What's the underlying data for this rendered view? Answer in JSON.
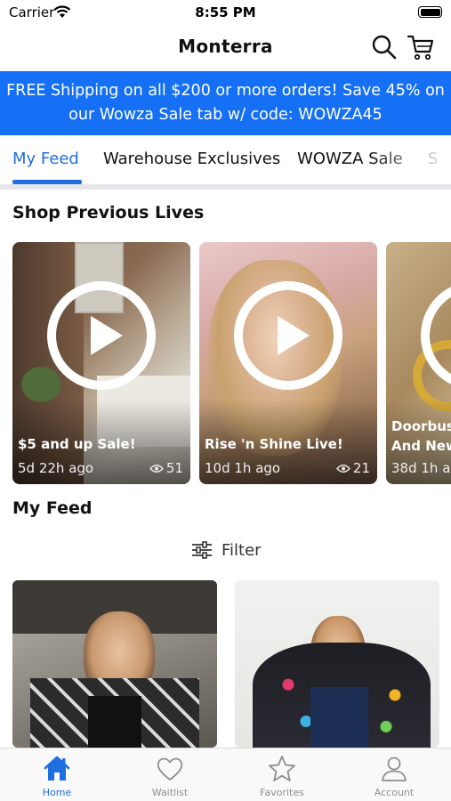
{
  "status_bar": {
    "carrier": "Carrier",
    "time": "8:55 PM"
  },
  "header": {
    "title": "Monterra",
    "icons": [
      "search-icon",
      "cart-icon"
    ]
  },
  "banner": {
    "text": "FREE Shipping on all $200 or more orders! Save 45% on our Wowza Sale tab w/ code: WOWZA45",
    "background": "#1570f5"
  },
  "tabs": [
    {
      "label": "My Feed",
      "active": true
    },
    {
      "label": "Warehouse Exclusives",
      "active": false
    },
    {
      "label": "WOWZA Sale",
      "active": false
    },
    {
      "label": "S",
      "active": false
    }
  ],
  "accent_color": "#1f6fe0",
  "previous_lives": {
    "heading": "Shop Previous Lives",
    "items": [
      {
        "title": "$5 and up Sale!",
        "time_ago": "5d 22h ago",
        "views": "51"
      },
      {
        "title": "Rise 'n Shine Live!",
        "time_ago": "10d 1h ago",
        "views": "21"
      },
      {
        "title": "Doorbus",
        "title_line2": "And New",
        "time_ago": "38d 1h a"
      }
    ]
  },
  "feed": {
    "heading": "My Feed",
    "filter_label": "Filter"
  },
  "tabbar": [
    {
      "label": "Home",
      "icon": "home-icon",
      "active": true
    },
    {
      "label": "Waitlist",
      "icon": "heart-icon",
      "active": false
    },
    {
      "label": "Favorites",
      "icon": "star-icon",
      "active": false
    },
    {
      "label": "Account",
      "icon": "person-icon",
      "active": false
    }
  ]
}
